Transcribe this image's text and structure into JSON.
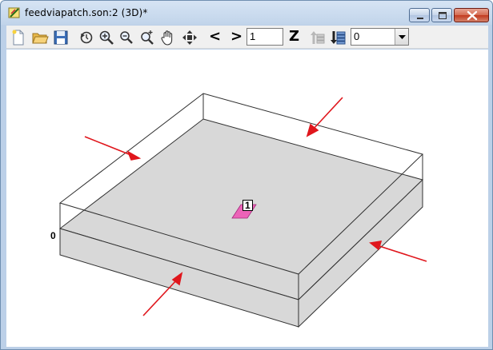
{
  "window": {
    "title": "feedviapatch.son:2 (3D)*"
  },
  "toolbar": {
    "icons": [
      "new-icon",
      "open-folder-icon",
      "save-disk-icon",
      "rotate-icon",
      "zoom-in-icon",
      "zoom-out-icon",
      "zoom-fit-icon",
      "pan-hand-icon",
      "move-arrows-icon",
      "previous-level-icon",
      "next-level-icon",
      "z-view-icon",
      "layer-up-icon",
      "layer-down-icon"
    ],
    "prev_label": "<",
    "next_label": ">",
    "level_value": "1",
    "z_label": "Z",
    "layer_select_value": "0"
  },
  "canvas": {
    "level_label": "0",
    "port_label": "1",
    "colors": {
      "substrate": "#d8d8d8",
      "port_patch": "#ec63b8",
      "arrows": "#e0161c",
      "box_outline": "#303030"
    }
  }
}
